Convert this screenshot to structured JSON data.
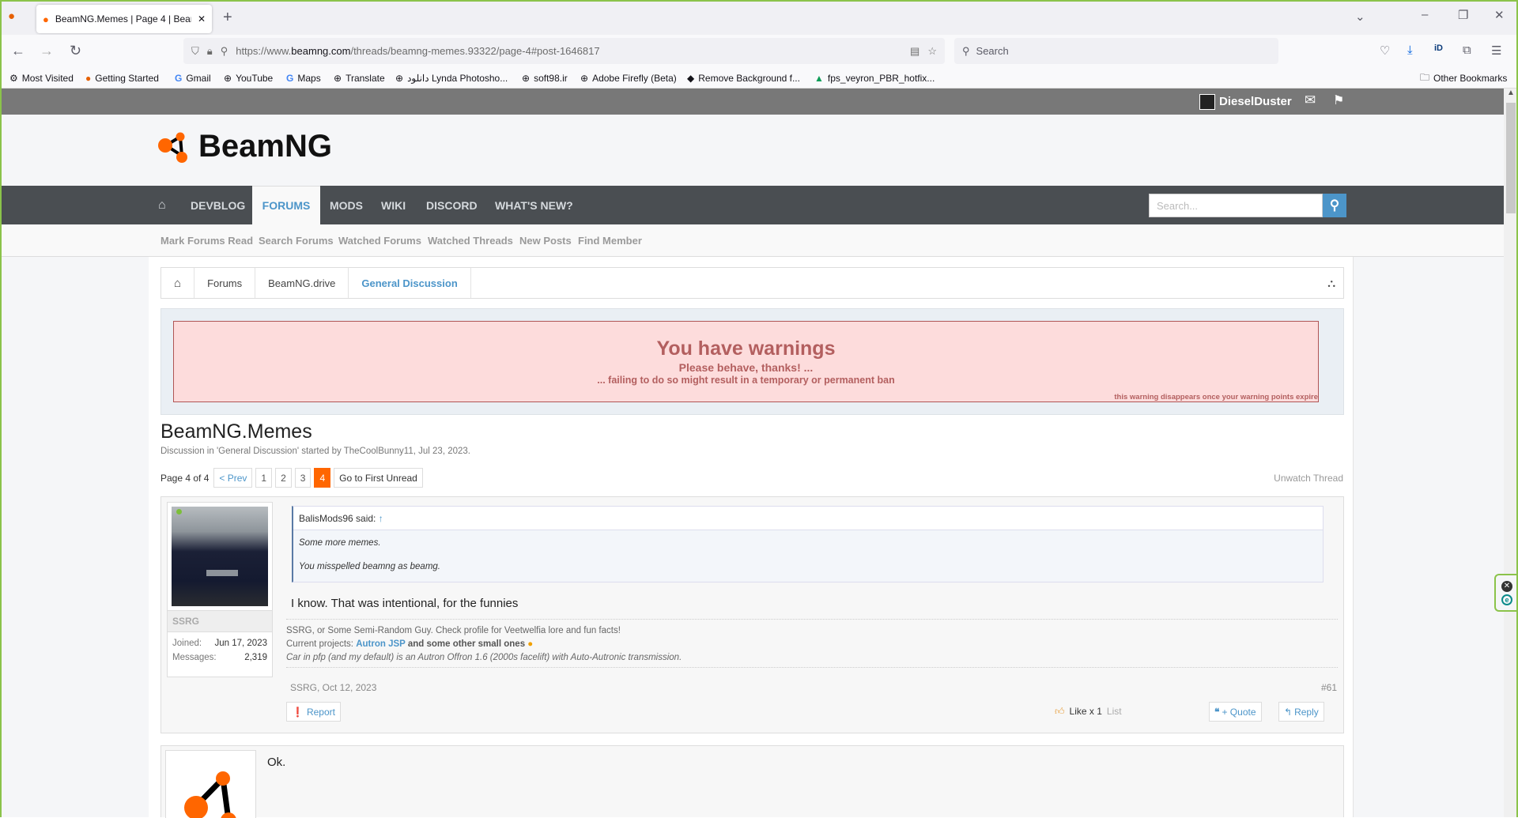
{
  "browser": {
    "tab_title": "BeamNG.Memes | Page 4 | Beam",
    "url_prefix": "https://www.",
    "url_domain": "beamng.com",
    "url_path": "/threads/beamng-memes.93322/page-4#post-1646817",
    "search_placeholder": "Search",
    "bookmarks": [
      "Most Visited",
      "Getting Started",
      "Gmail",
      "YouTube",
      "Maps",
      "Translate",
      "دانلود Lynda Photosho...",
      "soft98.ir",
      "Adobe Firefly (Beta)",
      "Remove Background f...",
      "fps_veyron_PBR_hotfix..."
    ],
    "other_bookmarks": "Other Bookmarks"
  },
  "site": {
    "username": "DieselDuster",
    "logo_text": "BeamNG",
    "nav": [
      "DEVBLOG",
      "FORUMS",
      "MODS",
      "WIKI",
      "DISCORD",
      "WHAT'S NEW?"
    ],
    "search_placeholder": "Search...",
    "subnav": [
      "Mark Forums Read",
      "Search Forums",
      "Watched Forums",
      "Watched Threads",
      "New Posts",
      "Find Member"
    ],
    "breadcrumbs": [
      "Forums",
      "BeamNG.drive",
      "General Discussion"
    ],
    "accent": "#4c95c9",
    "brand": "#ff6600"
  },
  "warning": {
    "title": "You have warnings",
    "line1": "Please behave, thanks! ...",
    "line2": "... failing to do so might result in a temporary or permanent ban",
    "footer": "this warning disappears once your warning points expire"
  },
  "thread": {
    "title": "BeamNG.Memes",
    "meta": "Discussion in 'General Discussion' started by TheCoolBunny11, Jul 23, 2023.",
    "page_label": "Page 4 of 4",
    "prev": "< Prev",
    "pages": [
      "1",
      "2",
      "3",
      "4"
    ],
    "current_page": "4",
    "first_unread": "Go to First Unread",
    "unwatch": "Unwatch Thread"
  },
  "post": {
    "author": "SSRG",
    "joined_label": "Joined:",
    "joined": "Jun 17, 2023",
    "messages_label": "Messages:",
    "messages": "2,319",
    "quote_author": "BalisMods96 said:",
    "quote_arrow": "↑",
    "quote_line1": "Some more memes.",
    "quote_line2": "You misspelled beamng as beamg.",
    "message": "I know. That was intentional, for the funnies",
    "sig1": "SSRG, or Some Semi-Random Guy. Check profile for Veetwelfia lore and fun facts!",
    "sig2_label": "Current projects: ",
    "sig2_link": "Autron JSP",
    "sig2_rest": " and some other small ones",
    "sig3": "Car in pfp (and my default) is an Autron Offron 1.6 (2000s facelift) with Auto-Autronic transmission.",
    "date": "SSRG, Oct 12, 2023",
    "number": "#61",
    "report": "Report",
    "likes": "Like x 1",
    "list": "List",
    "quote_btn": "+ Quote",
    "reply": "Reply"
  },
  "post2": {
    "message": "Ok."
  }
}
